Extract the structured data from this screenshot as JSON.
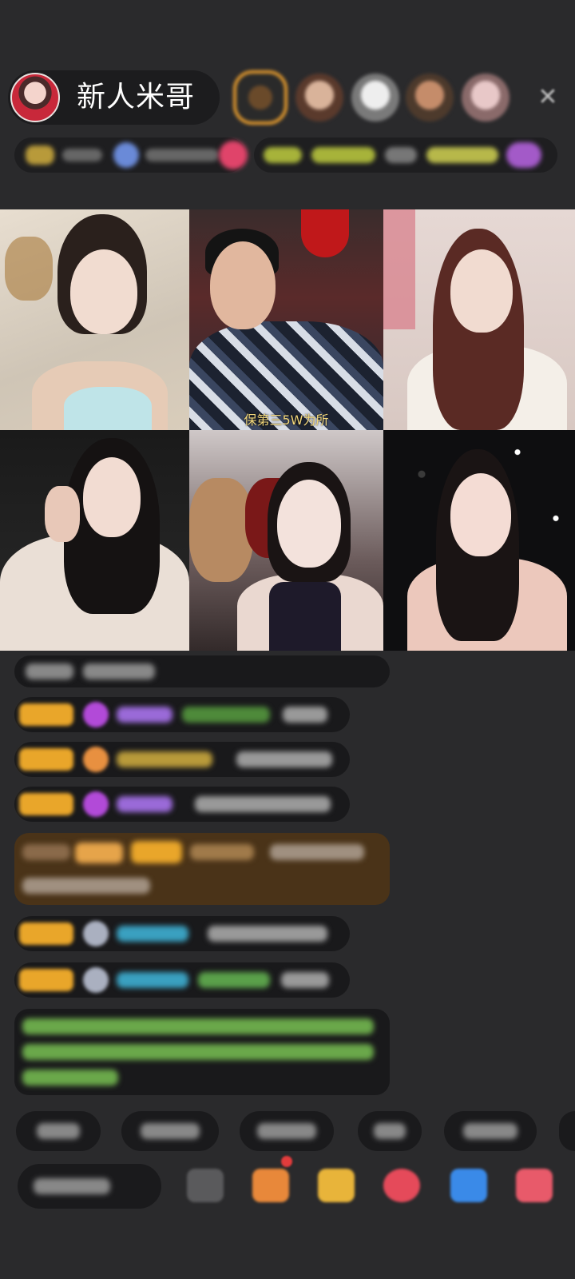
{
  "host": {
    "name": "新人米哥"
  },
  "top_bar": {
    "close_icon": "close-icon"
  },
  "video_grid": {
    "caption": "保第三5W为所"
  },
  "colors": {
    "background": "#2a2a2c",
    "badge": "#e9a62a",
    "highlight_message": "#4a3318",
    "green_text": "#7fbf4a"
  }
}
